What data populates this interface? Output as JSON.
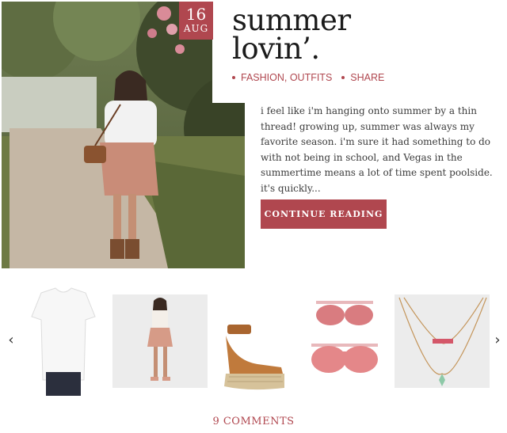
{
  "post": {
    "date": {
      "day": "16",
      "month": "AUG"
    },
    "title": "summer\nlovin’.",
    "categories": [
      "FASHION",
      "OUTFITS"
    ],
    "categories_text": "FASHION, OUTFITS",
    "share_label": "SHARE",
    "excerpt": "i feel like i'm hanging onto summer by a thin thread! growing up, summer was always my favorite season. i'm sure it had something to do with not being in school, and Vegas in the summertime means a lot of time spent poolside. it's quickly...",
    "cta_label": "CONTINUE READING",
    "comments_label": "9 COMMENTS"
  },
  "carousel": {
    "prev_icon": "chevron-left-icon",
    "next_icon": "chevron-right-icon",
    "prev_glyph": "‹",
    "next_glyph": "›",
    "items": [
      {
        "name": "white-tee"
      },
      {
        "name": "pink-shorts-outfit"
      },
      {
        "name": "espadrille-wedge"
      },
      {
        "name": "pink-sunglasses"
      },
      {
        "name": "layered-necklace"
      }
    ]
  },
  "colors": {
    "accent": "#b0474f",
    "text": "#1b1b1b",
    "body": "#3b3b3b"
  }
}
